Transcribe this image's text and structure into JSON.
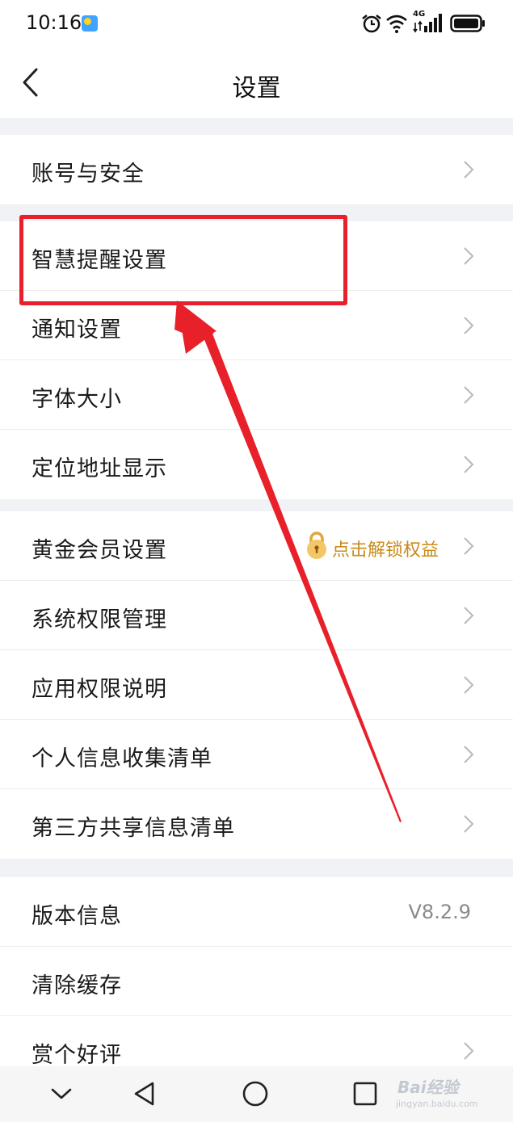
{
  "status_bar": {
    "time": "10:16",
    "network_label": "4G",
    "icons": [
      "weather-icon",
      "alarm-icon",
      "wifi-icon",
      "signal-icon",
      "battery-icon"
    ]
  },
  "header": {
    "title": "设置",
    "back_icon": "chevron-left-icon"
  },
  "sections": [
    {
      "items": [
        {
          "label": "账号与安全"
        }
      ]
    },
    {
      "items": [
        {
          "label": "智慧提醒设置"
        },
        {
          "label": "通知设置"
        },
        {
          "label": "字体大小"
        },
        {
          "label": "定位地址显示"
        }
      ]
    },
    {
      "items": [
        {
          "label": "黄金会员设置",
          "badge": "点击解锁权益"
        },
        {
          "label": "系统权限管理"
        },
        {
          "label": "应用权限说明"
        },
        {
          "label": "个人信息收集清单"
        },
        {
          "label": "第三方共享信息清单"
        }
      ]
    },
    {
      "items": [
        {
          "label": "版本信息",
          "value": "V8.2.9"
        },
        {
          "label": "清除缓存"
        },
        {
          "label": "赏个好评"
        }
      ]
    }
  ],
  "nav_bar": {
    "buttons": [
      "chevron-down-icon",
      "back-triangle-icon",
      "home-circle-icon",
      "recents-square-icon"
    ]
  },
  "watermark": {
    "brand": "Bai经验",
    "site": "jingyan.baidu.com"
  },
  "annotation": {
    "highlight_color": "#e8202a"
  },
  "colors": {
    "accent_gold": "#c98a1b",
    "background": "#f1f2f6"
  }
}
